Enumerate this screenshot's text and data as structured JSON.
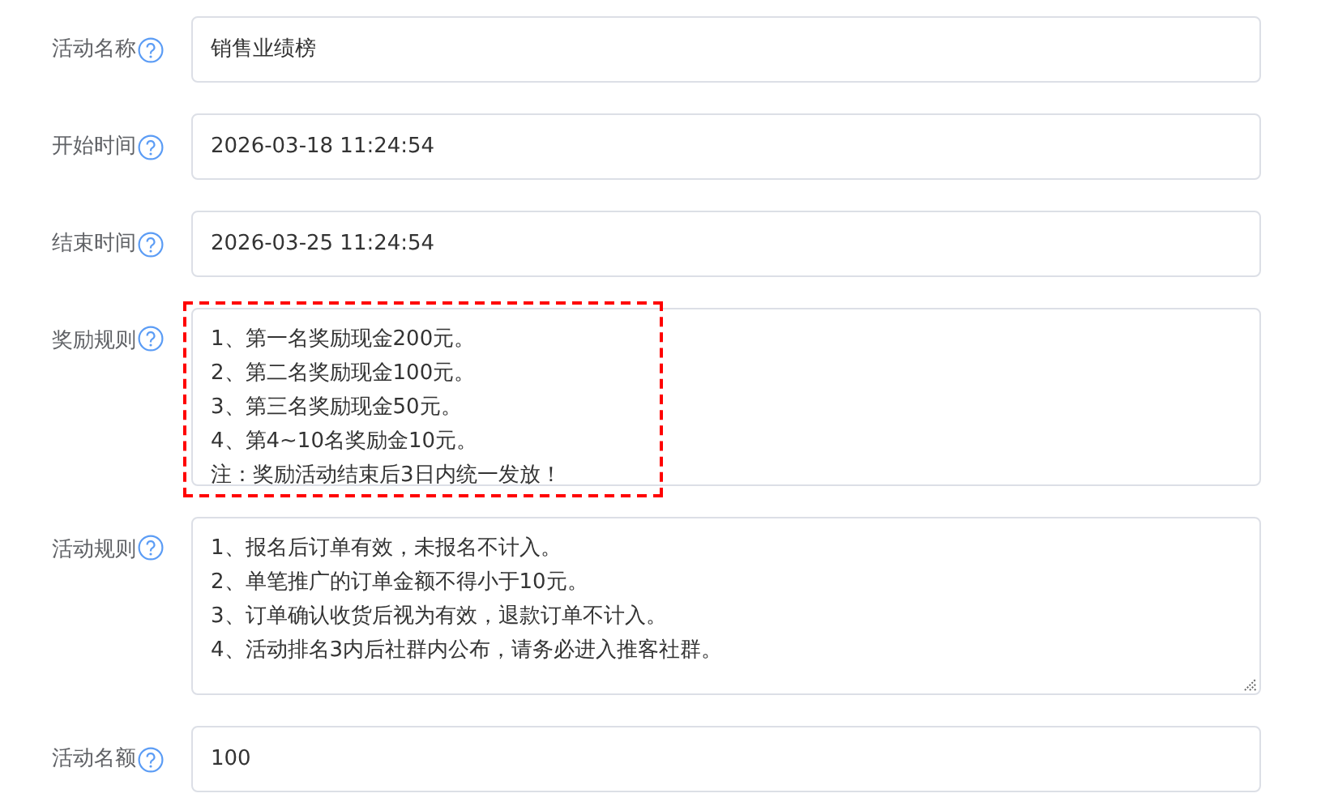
{
  "fields": [
    {
      "kind": "input",
      "label": "活动名称",
      "value": "销售业绩榜"
    },
    {
      "kind": "input",
      "label": "开始时间",
      "value": "2026-03-18 11:24:54"
    },
    {
      "kind": "input",
      "label": "结束时间",
      "value": "2026-03-25 11:24:54"
    },
    {
      "kind": "textarea",
      "label": "奖励规则",
      "highlighted": true,
      "resize_handle": false,
      "lines": [
        "1、第一名奖励现金200元。",
        "2、第二名奖励现金100元。",
        "3、第三名奖励现金50元。",
        "4、第4~10名奖励金10元。",
        "注：奖励活动结束后3日内统一发放！"
      ]
    },
    {
      "kind": "textarea",
      "label": "活动规则",
      "highlighted": false,
      "resize_handle": true,
      "lines": [
        "1、报名后订单有效，未报名不计入。",
        "2、单笔推广的订单金额不得小于10元。",
        "3、订单确认收货后视为有效，退款订单不计入。",
        "4、活动排名3内后社群内公布，请务必进入推客社群。"
      ]
    },
    {
      "kind": "input",
      "label": "活动名额",
      "value": "100"
    }
  ]
}
